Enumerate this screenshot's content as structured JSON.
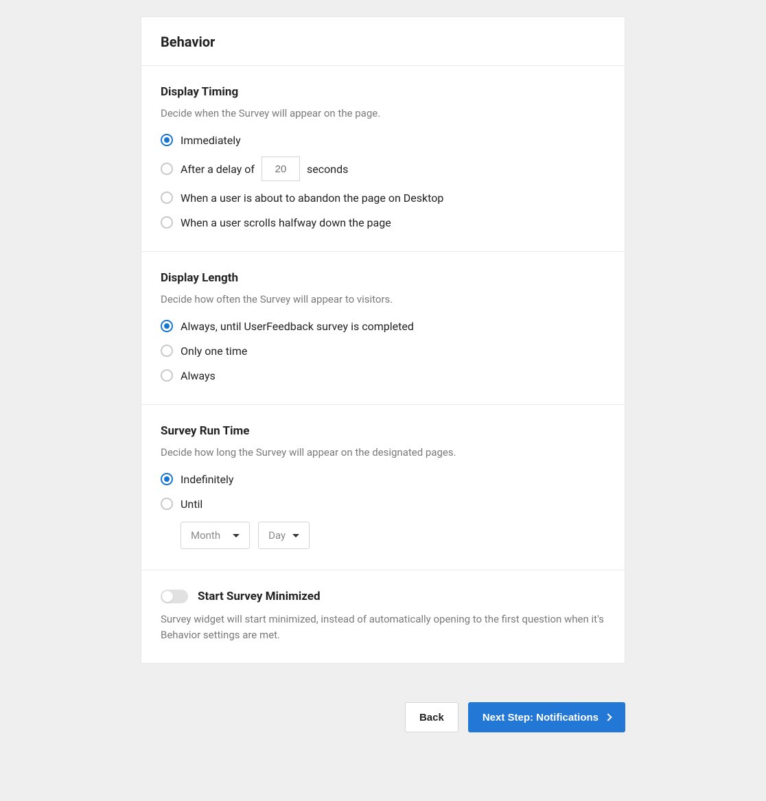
{
  "header": {
    "title": "Behavior"
  },
  "display_timing": {
    "title": "Display Timing",
    "subtitle": "Decide when the Survey will appear on the page.",
    "options": {
      "immediately": "Immediately",
      "delay_prefix": "After a delay of",
      "delay_value": "20",
      "delay_suffix": "seconds",
      "abandon": "When a user is about to abandon the page on Desktop",
      "scroll": "When a user scrolls halfway down the page"
    },
    "selected": "immediately"
  },
  "display_length": {
    "title": "Display Length",
    "subtitle": "Decide how often the Survey will appear to visitors.",
    "options": {
      "until_completed": "Always, until UserFeedback survey is completed",
      "one_time": "Only one time",
      "always": "Always"
    },
    "selected": "until_completed"
  },
  "run_time": {
    "title": "Survey Run Time",
    "subtitle": "Decide how long the Survey will appear on the designated pages.",
    "options": {
      "indefinitely": "Indefinitely",
      "until": "Until"
    },
    "month_placeholder": "Month",
    "day_placeholder": "Day",
    "selected": "indefinitely"
  },
  "minimized": {
    "title": "Start Survey Minimized",
    "description": "Survey widget will start minimized, instead of automatically opening to the first question when it's Behavior settings are met.",
    "enabled": false
  },
  "footer": {
    "back": "Back",
    "next": "Next Step: Notifications"
  }
}
